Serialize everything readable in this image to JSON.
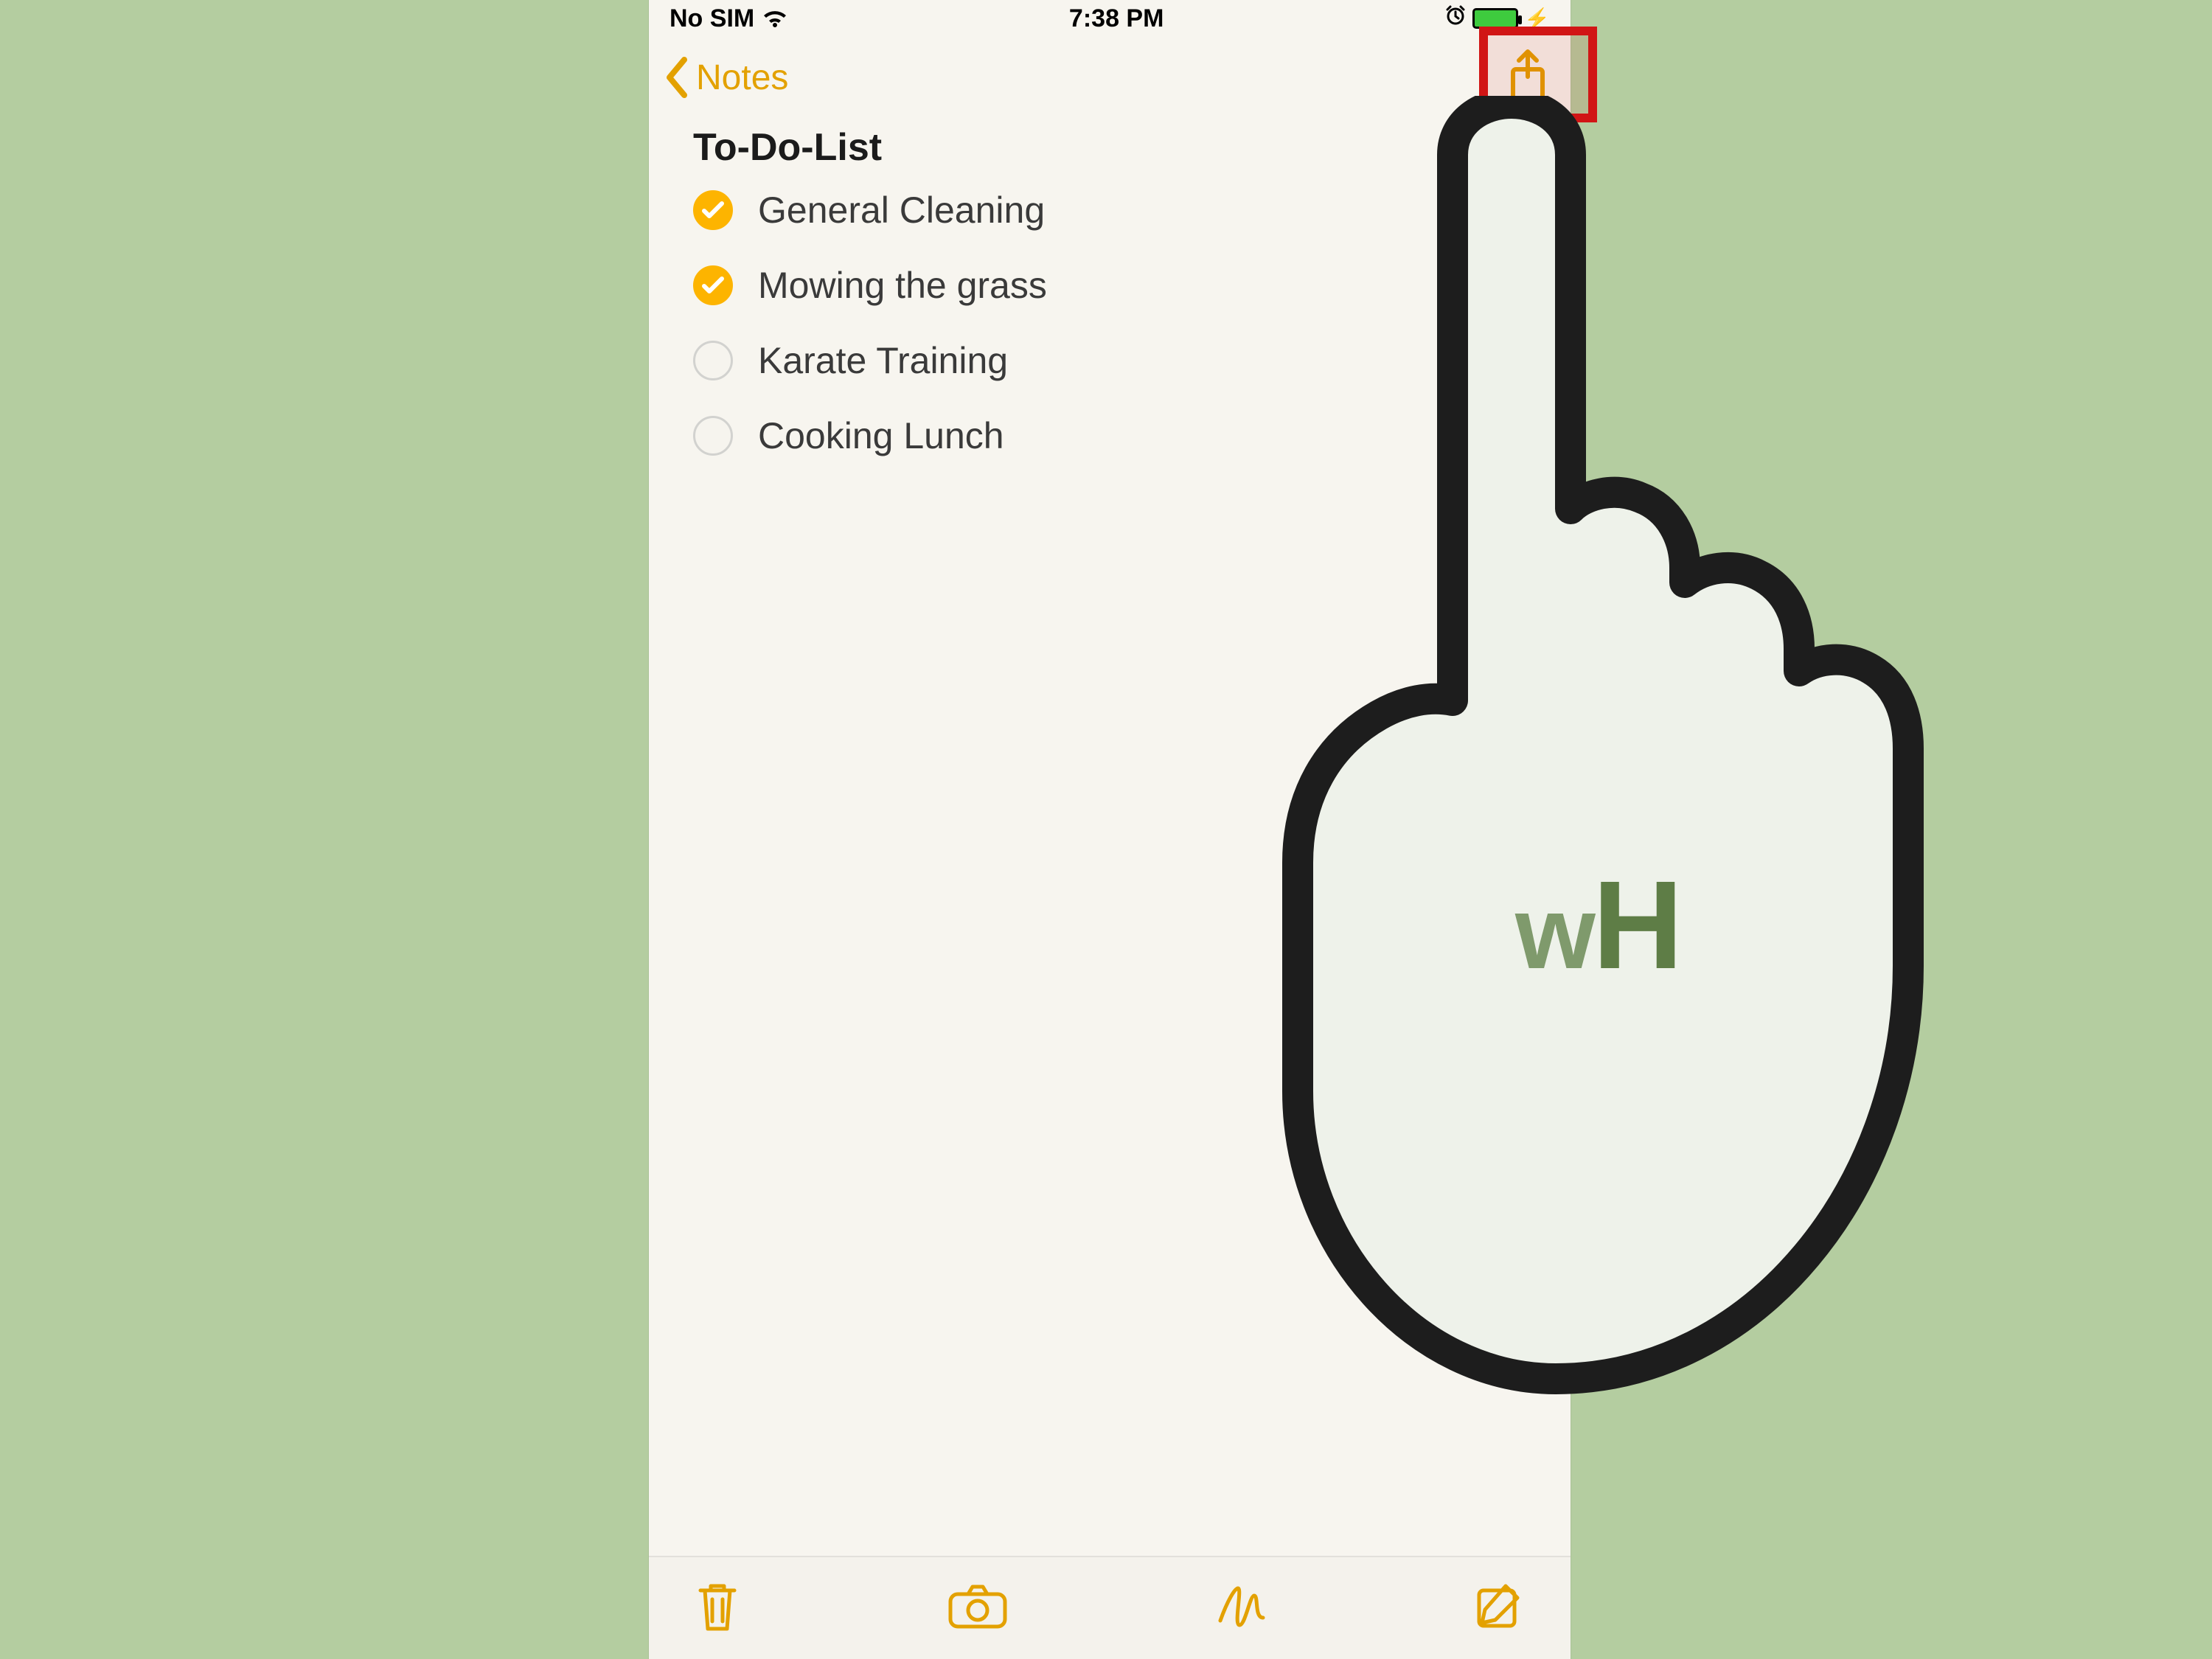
{
  "statusbar": {
    "carrier": "No SIM",
    "time": "7:38 PM",
    "charging": "⚡"
  },
  "nav": {
    "back_label": "Notes"
  },
  "note": {
    "title": "To-Do-List",
    "items": [
      {
        "label": "General Cleaning",
        "done": true
      },
      {
        "label": "Mowing the grass",
        "done": true
      },
      {
        "label": "Karate Training",
        "done": false
      },
      {
        "label": "Cooking Lunch",
        "done": false
      }
    ]
  },
  "icons": {
    "wifi": "wifi-icon",
    "alarm": "alarm-icon",
    "battery": "battery-icon",
    "chevron_left": "chevron-left-icon",
    "share": "share-icon",
    "trash": "trash-icon",
    "camera": "camera-icon",
    "sketch": "sketch-icon",
    "compose": "compose-icon"
  },
  "overlay": {
    "brand_w": "w",
    "brand_h": "H"
  },
  "colors": {
    "accent": "#e3a100",
    "highlight_border": "#d11515",
    "page_bg": "#b4cda0"
  }
}
